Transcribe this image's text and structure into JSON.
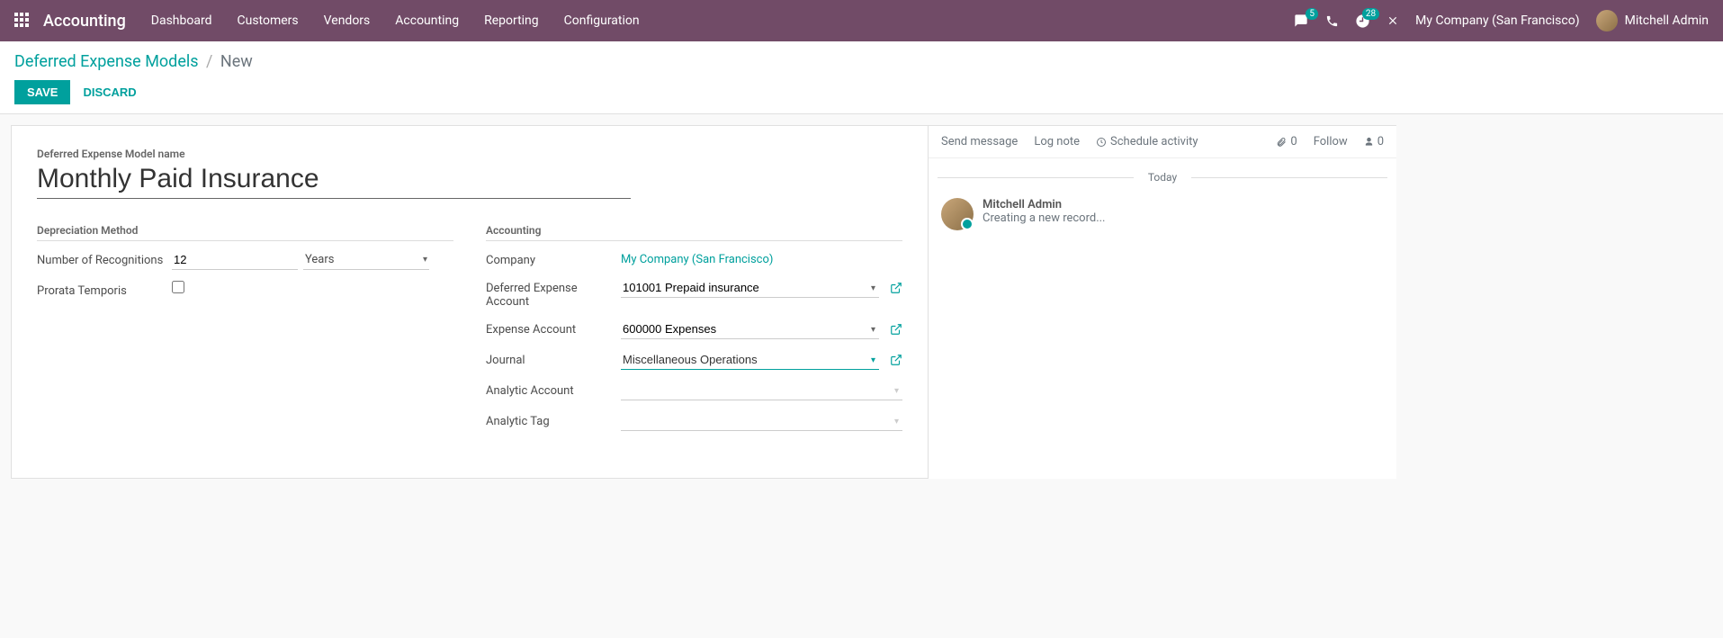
{
  "navbar": {
    "brand": "Accounting",
    "menu": [
      "Dashboard",
      "Customers",
      "Vendors",
      "Accounting",
      "Reporting",
      "Configuration"
    ],
    "messages_badge": "5",
    "activities_badge": "28",
    "company": "My Company (San Francisco)",
    "user": "Mitchell Admin"
  },
  "breadcrumb": {
    "parent": "Deferred Expense Models",
    "current": "New"
  },
  "actions": {
    "save": "Save",
    "discard": "Discard"
  },
  "form": {
    "title_label": "Deferred Expense Model name",
    "title_value": "Monthly Paid Insurance",
    "left_section": "Depreciation Method",
    "right_section": "Accounting",
    "fields": {
      "num_recog_label": "Number of Recognitions",
      "num_recog_value": "12",
      "num_recog_unit": "Years",
      "prorata_label": "Prorata Temporis",
      "company_label": "Company",
      "company_value": "My Company (San Francisco)",
      "def_exp_acct_label": "Deferred Expense Account",
      "def_exp_acct_value": "101001 Prepaid insurance",
      "exp_acct_label": "Expense Account",
      "exp_acct_value": "600000 Expenses",
      "journal_label": "Journal",
      "journal_value": "Miscellaneous Operations",
      "analytic_acct_label": "Analytic Account",
      "analytic_acct_value": "",
      "analytic_tag_label": "Analytic Tag",
      "analytic_tag_value": ""
    }
  },
  "chatter": {
    "send_message": "Send message",
    "log_note": "Log note",
    "schedule_activity": "Schedule activity",
    "attach_count": "0",
    "follow": "Follow",
    "follower_count": "0",
    "date_sep": "Today",
    "msg_author": "Mitchell Admin",
    "msg_text": "Creating a new record..."
  }
}
